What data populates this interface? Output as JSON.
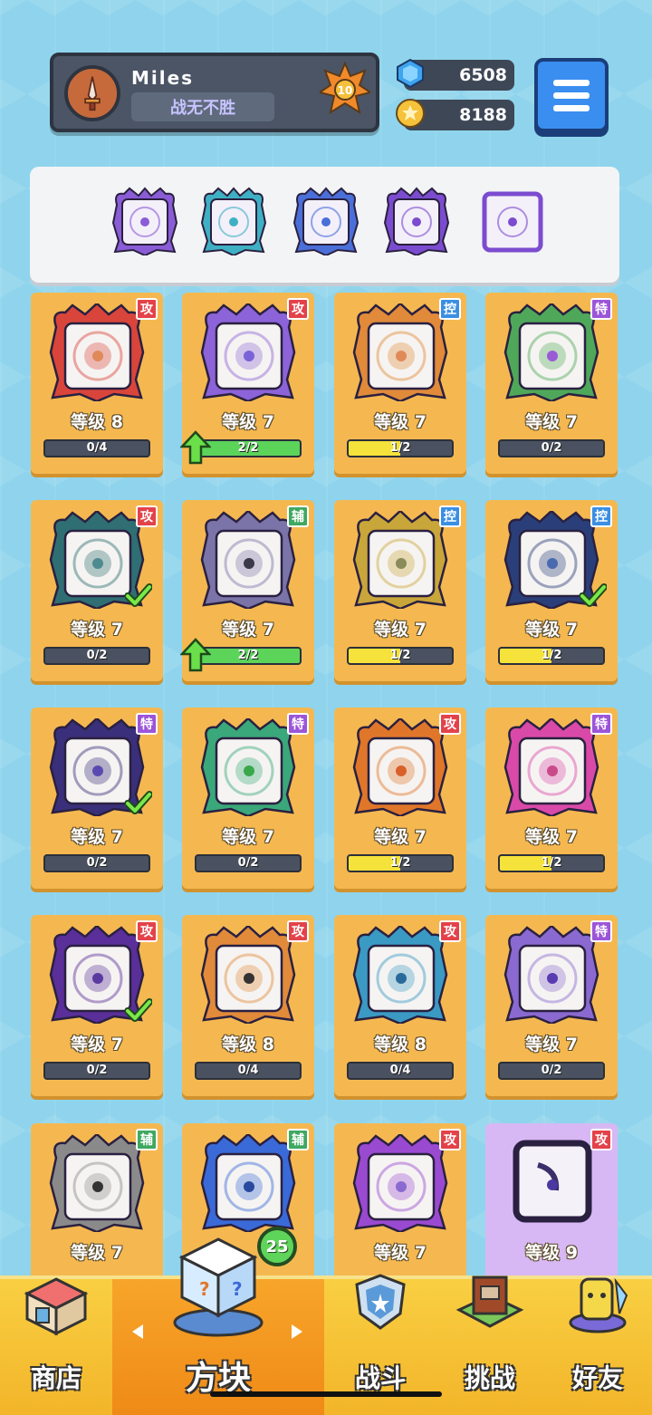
{
  "player": {
    "name": "Miles",
    "title": "战无不胜",
    "rank_level": "10",
    "gems": "6508",
    "coins": "8188"
  },
  "menu": {
    "icon": "hamburger-icon"
  },
  "deck": {
    "slots": [
      {
        "color": "#8a5cd6"
      },
      {
        "color": "#3fb0c4"
      },
      {
        "color": "#4a6fd8"
      },
      {
        "color": "#7b4ccf"
      },
      {
        "color": "#7b4ccf"
      }
    ]
  },
  "tags": {
    "attack": "攻",
    "control": "控",
    "special": "特",
    "support": "辅"
  },
  "tag_colors": {
    "攻": "#e3424a",
    "控": "#3b8fe2",
    "特": "#9b55d9",
    "辅": "#3fa861"
  },
  "cards": [
    {
      "level": "等级 8",
      "progress_text": "0/4",
      "progress": 0,
      "tag": "攻",
      "color": "#d9453b",
      "dot": "#e08a5a",
      "upgrade": false,
      "equipped": false
    },
    {
      "level": "等级 7",
      "progress_text": "2/2",
      "progress": 1,
      "tag": "攻",
      "color": "#8c63d8",
      "dot": "#7a63d8",
      "upgrade": true,
      "equipped": false
    },
    {
      "level": "等级 7",
      "progress_text": "1/2",
      "progress": 0.5,
      "tag": "控",
      "color": "#e08a3a",
      "dot": "#e08a5a",
      "upgrade": false,
      "equipped": false
    },
    {
      "level": "等级 7",
      "progress_text": "0/2",
      "progress": 0,
      "tag": "特",
      "color": "#4fa85a",
      "dot": "#9a5ad6",
      "upgrade": false,
      "equipped": false
    },
    {
      "level": "等级 7",
      "progress_text": "0/2",
      "progress": 0,
      "tag": "攻",
      "color": "#2f6f74",
      "dot": "#4d8b8f",
      "upgrade": false,
      "equipped": true
    },
    {
      "level": "等级 7",
      "progress_text": "2/2",
      "progress": 1,
      "tag": "辅",
      "color": "#7b74a8",
      "dot": "#3a3a4a",
      "upgrade": true,
      "equipped": false
    },
    {
      "level": "等级 7",
      "progress_text": "1/2",
      "progress": 0.5,
      "tag": "控",
      "color": "#c9a63a",
      "dot": "#8a8a5a",
      "upgrade": false,
      "equipped": false
    },
    {
      "level": "等级 7",
      "progress_text": "1/2",
      "progress": 0.5,
      "tag": "控",
      "color": "#2a3f7a",
      "dot": "#4a6ab0",
      "upgrade": false,
      "equipped": true
    },
    {
      "level": "等级 7",
      "progress_text": "0/2",
      "progress": 0,
      "tag": "特",
      "color": "#3a2f7a",
      "dot": "#5a4ab0",
      "upgrade": false,
      "equipped": true
    },
    {
      "level": "等级 7",
      "progress_text": "0/2",
      "progress": 0,
      "tag": "特",
      "color": "#3aa87a",
      "dot": "#3aa84a",
      "upgrade": false,
      "equipped": false
    },
    {
      "level": "等级 7",
      "progress_text": "1/2",
      "progress": 0.5,
      "tag": "攻",
      "color": "#e0762a",
      "dot": "#d9602a",
      "upgrade": false,
      "equipped": false
    },
    {
      "level": "等级 7",
      "progress_text": "1/2",
      "progress": 0.5,
      "tag": "特",
      "color": "#d94aa8",
      "dot": "#c94a8a",
      "upgrade": false,
      "equipped": false
    },
    {
      "level": "等级 7",
      "progress_text": "0/2",
      "progress": 0,
      "tag": "攻",
      "color": "#5a2f9a",
      "dot": "#5a3aa0",
      "upgrade": false,
      "equipped": true
    },
    {
      "level": "等级 8",
      "progress_text": "0/4",
      "progress": 0,
      "tag": "攻",
      "color": "#e08a3a",
      "dot": "#333333",
      "upgrade": false,
      "equipped": false
    },
    {
      "level": "等级 8",
      "progress_text": "0/4",
      "progress": 0,
      "tag": "攻",
      "color": "#3a9ac4",
      "dot": "#2a6a9a",
      "upgrade": false,
      "equipped": false
    },
    {
      "level": "等级 7",
      "progress_text": "0/2",
      "progress": 0,
      "tag": "特",
      "color": "#8a6ad0",
      "dot": "#5a3ab0",
      "upgrade": false,
      "equipped": false
    },
    {
      "level": "等级 7",
      "progress_text": "",
      "progress": 0,
      "tag": "辅",
      "color": "#8a8a8a",
      "dot": "#333333",
      "upgrade": false,
      "equipped": false
    },
    {
      "level": "",
      "progress_text": "",
      "progress": 0,
      "tag": "辅",
      "color": "#3a6ad8",
      "dot": "#2a4aa0",
      "upgrade": false,
      "equipped": false
    },
    {
      "level": "等级 7",
      "progress_text": "",
      "progress": 0,
      "tag": "攻",
      "color": "#9a4ad0",
      "dot": "#8a6ad0",
      "upgrade": false,
      "equipped": false
    },
    {
      "level": "等级 9",
      "progress_text": "",
      "progress": 0,
      "tag": "攻",
      "color": "#3a2f6a",
      "dot": "#4a3aa0",
      "upgrade": false,
      "equipped": false,
      "special": true
    }
  ],
  "nav": {
    "shop": "商店",
    "blocks": "方块",
    "battle": "战斗",
    "challenge": "挑战",
    "friends": "好友",
    "blocks_badge": "25"
  }
}
